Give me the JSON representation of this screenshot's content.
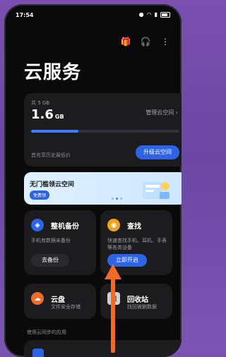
{
  "status": {
    "time": "17:54",
    "battery": "35"
  },
  "app": {
    "title": "云服务"
  },
  "storage": {
    "total": "共 5 GB",
    "used_value": "1.6",
    "used_unit": "GB",
    "used_fraction": 0.32,
    "manage_label": "管理云空间",
    "promo_text": "首充享历史最低价",
    "upgrade_label": "升级云空间"
  },
  "banner": {
    "text": "无门槛领云空间",
    "badge": "免费领"
  },
  "tiles": [
    {
      "name": "整机备份",
      "desc": "手机有数据未备份",
      "button": "去备份",
      "color": "#2d63e6"
    },
    {
      "name": "查找",
      "desc": "快速查找手机、耳机、手表等各类设备",
      "button": "立即开启",
      "color": "#f0a21a"
    },
    {
      "name": "云盘",
      "desc": "文件安全存储",
      "color": "#f06a2a"
    },
    {
      "name": "回收站",
      "desc": "找回被删数据",
      "color": "#cfcfd4"
    }
  ],
  "section": {
    "label": "使用云同步的应用"
  },
  "colors": {
    "accent": "#2d63e6",
    "background": "#0a0a0b",
    "card": "#1c1c1f",
    "arrow": "#f26a26"
  }
}
